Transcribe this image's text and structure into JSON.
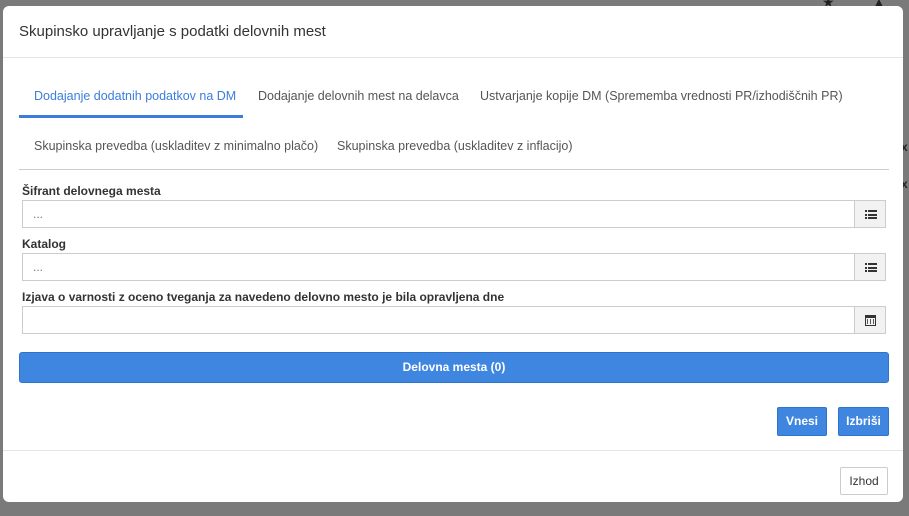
{
  "modal": {
    "title": "Skupinsko upravljanje s podatki delovnih mest"
  },
  "tabs": [
    {
      "label": "Dodajanje dodatnih podatkov na DM",
      "active": true
    },
    {
      "label": "Dodajanje delovnih mest na delavca",
      "active": false
    },
    {
      "label": "Ustvarjanje kopije DM (Sprememba vrednosti PR/izhodiščnih PR)",
      "active": false
    },
    {
      "label": "Skupinska prevedba (uskladitev z minimalno plačo)",
      "active": false
    },
    {
      "label": "Skupinska prevedba (uskladitev z inflacijo)",
      "active": false
    }
  ],
  "fields": {
    "sifrant": {
      "label": "Šifrant delovnega mesta",
      "placeholder": "...",
      "value": "",
      "icon": "list-icon"
    },
    "katalog": {
      "label": "Katalog",
      "placeholder": "...",
      "value": "",
      "icon": "list-icon"
    },
    "izjava": {
      "label": "Izjava o varnosti z oceno tveganja za navedeno delovno mesto je bila opravljena dne",
      "placeholder": "",
      "value": "",
      "icon": "calendar-icon"
    }
  },
  "delovna_mesta_button": "Delovna mesta (0)",
  "actions": {
    "vnesi": "Vnesi",
    "izbrisi": "Izbriši",
    "izhod": "Izhod"
  },
  "colors": {
    "accent": "#3b7ddd",
    "button_primary": "#3f86e0"
  }
}
